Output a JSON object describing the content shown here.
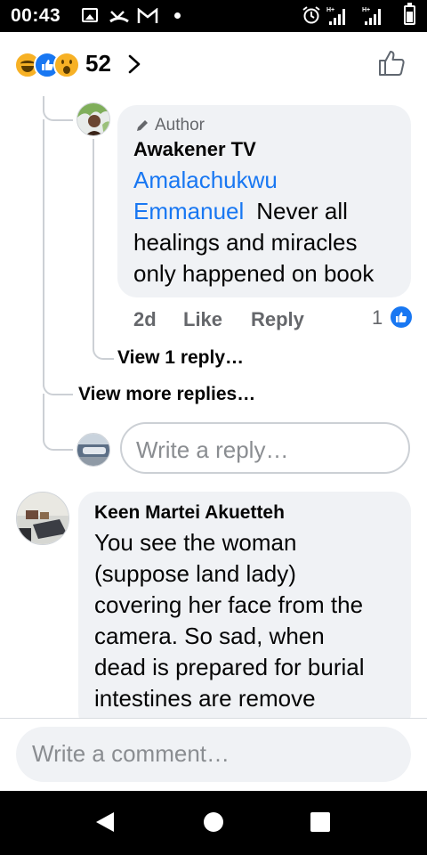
{
  "status_bar": {
    "time": "00:43",
    "icons": [
      "gallery-icon",
      "missed-call-icon",
      "gmail-icon",
      "notification-dot-icon",
      "alarm-icon",
      "signal-h-plus-icon",
      "signal-h-plus-icon",
      "battery-icon"
    ]
  },
  "reactions": {
    "types": [
      "haha",
      "like",
      "wow"
    ],
    "count": "52",
    "colors": {
      "like": "#1877f2",
      "haha": "#f7b125",
      "wow": "#f7b125"
    }
  },
  "reply": {
    "badge": "Author",
    "name": "Awakener TV",
    "mention_line1": "Amalachukwu",
    "mention_line2": "Emmanuel",
    "text_line1": "Never all",
    "text_line2": "healings and miracles",
    "text_line3": "only happened on book",
    "time": "2d",
    "like": "Like",
    "reply": "Reply",
    "like_count": "1"
  },
  "view_reply": "View 1 reply…",
  "view_more": "View more replies…",
  "reply_placeholder": "Write a reply…",
  "comment": {
    "name": "Keen Martei Akuetteh",
    "lines": [
      "You see the woman",
      "(suppose land lady)",
      "covering her face from the",
      "camera. So sad, when",
      "dead is prepared for burial",
      "intestines are remove"
    ]
  },
  "comment_placeholder": "Write a comment…",
  "nav": {
    "back": "back-icon",
    "home": "home-icon",
    "recents": "recents-icon"
  },
  "accent_color": "#1877f2"
}
